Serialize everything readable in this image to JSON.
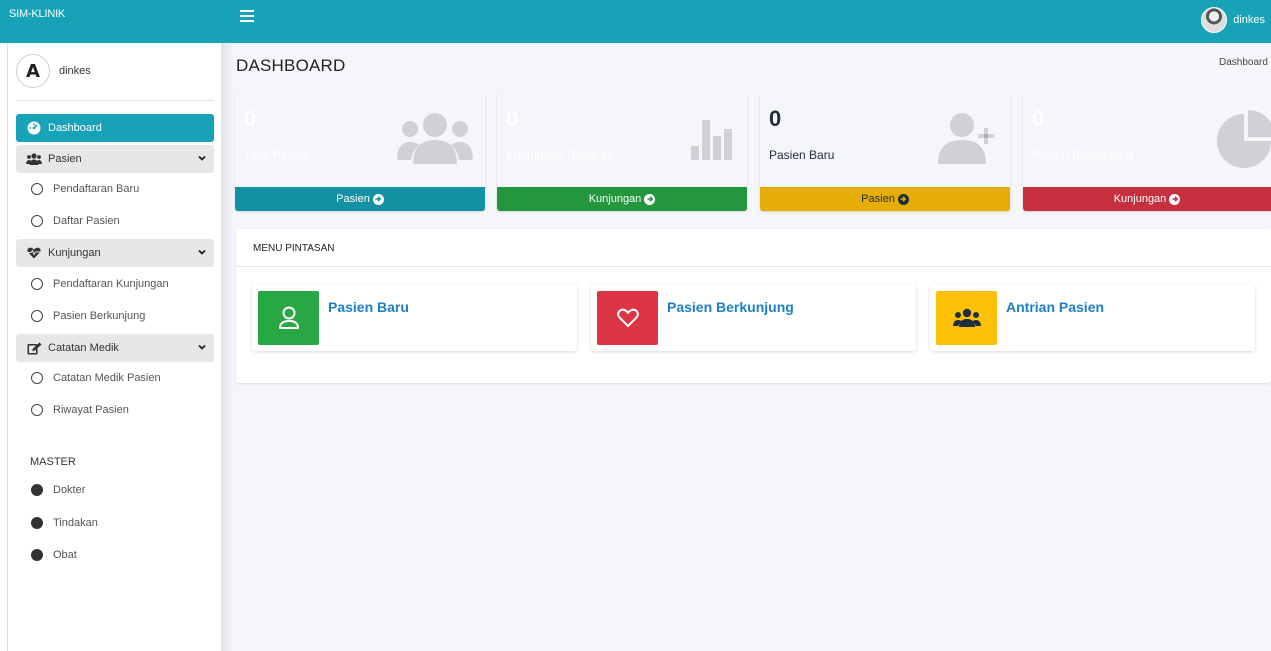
{
  "app": {
    "brand": "SIM-KLINIK",
    "user": "dinkes"
  },
  "sidebar": {
    "user_name": "dinkes",
    "logo_letter": "A",
    "items": [
      {
        "label": "Dashboard"
      },
      {
        "label": "Pasien"
      },
      {
        "label": "Pendaftaran Baru"
      },
      {
        "label": "Daftar Pasien"
      },
      {
        "label": "Kunjungan"
      },
      {
        "label": "Pendaftaran Kunjungan"
      },
      {
        "label": "Pasien Berkunjung"
      },
      {
        "label": "Catatan Medik"
      },
      {
        "label": "Catatan Medik Pasien"
      },
      {
        "label": "Riwayat Pasien"
      }
    ],
    "master_header": "MASTER",
    "master_items": [
      {
        "label": "Dokter"
      },
      {
        "label": "Tindakan"
      },
      {
        "label": "Obat"
      }
    ]
  },
  "page": {
    "title": "DASHBOARD",
    "breadcrumb": "Dashboard"
  },
  "boxes": [
    {
      "value": "0",
      "label": "Total Pasien",
      "link": "Pasien",
      "color": "#17a2b8",
      "footer_color": "#1591a5",
      "icon": "users-icon"
    },
    {
      "value": "0",
      "label": "Kunjungan Bulan ini",
      "link": "Kunjungan",
      "color": "#28a745",
      "footer_color": "#24963e",
      "icon": "bar-chart-icon"
    },
    {
      "value": "0",
      "label": "Pasien Baru",
      "link": "Pasien",
      "color": "#ffc107",
      "footer_color": "#e5ad06",
      "icon": "user-plus-icon"
    },
    {
      "value": "0",
      "label": "Pasien Berkunjung",
      "link": "Kunjungan",
      "color": "#dc3545",
      "footer_color": "#c62f3e",
      "icon": "pie-chart-icon"
    }
  ],
  "shortcuts": {
    "header": "MENU PINTASAN",
    "items": [
      {
        "title": "Pasien Baru",
        "color": "#28a745",
        "icon": "user-icon"
      },
      {
        "title": "Pasien Berkunjung",
        "color": "#dc3545",
        "icon": "heart-icon"
      },
      {
        "title": "Antrian Pasien",
        "color": "#ffc107",
        "icon": "users-icon"
      }
    ]
  }
}
